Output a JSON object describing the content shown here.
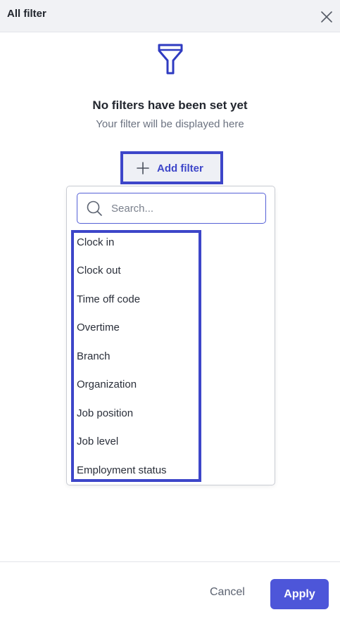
{
  "header": {
    "title": "All filter",
    "close_icon": "close-icon"
  },
  "empty_state": {
    "icon": "funnel-icon",
    "title": "No filters have been set yet",
    "subtitle": "Your filter will be displayed here"
  },
  "add_filter": {
    "icon": "plus-icon",
    "label": "Add filter"
  },
  "dropdown": {
    "search": {
      "icon": "search-icon",
      "placeholder": "Search...",
      "value": ""
    },
    "options": [
      "Clock in",
      "Clock out",
      "Time off code",
      "Overtime",
      "Branch",
      "Organization",
      "Job position",
      "Job level",
      "Employment status"
    ]
  },
  "footer": {
    "cancel_label": "Cancel",
    "apply_label": "Apply"
  },
  "colors": {
    "accent": "#3d46c9",
    "apply_button": "#4d56d9",
    "header_bg": "#f1f2f5"
  }
}
